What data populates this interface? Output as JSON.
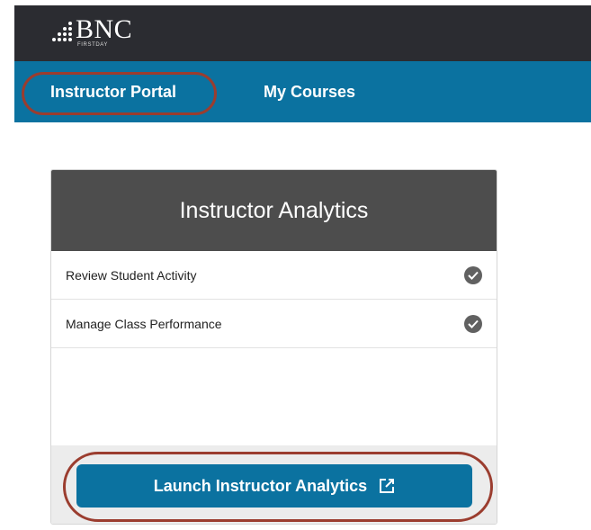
{
  "header": {
    "brand": "BNC",
    "brand_sub": "FIRSTDAY",
    "logo_icon": "dot-grid-icon"
  },
  "nav": {
    "items": [
      {
        "label": "Instructor Portal"
      },
      {
        "label": "My Courses"
      }
    ],
    "highlight_color": "#9b3d2f"
  },
  "card": {
    "title": "Instructor Analytics",
    "features": [
      {
        "label": "Review Student Activity",
        "icon": "check-circle-icon"
      },
      {
        "label": "Manage Class Performance",
        "icon": "check-circle-icon"
      }
    ],
    "launch_label": "Launch Instructor Analytics",
    "launch_icon": "external-link-icon"
  },
  "colors": {
    "topbar": "#2b2c31",
    "navbar": "#0b72a0",
    "card_header": "#4d4d4d",
    "button": "#0b72a0",
    "annotation_ring": "#9b3d2f"
  }
}
